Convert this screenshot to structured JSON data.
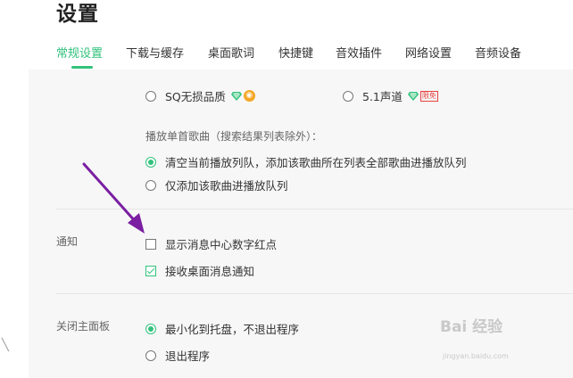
{
  "page": {
    "title": "设置"
  },
  "tabs": [
    {
      "label": "常规设置",
      "active": true
    },
    {
      "label": "下载与缓存",
      "active": false
    },
    {
      "label": "桌面歌词",
      "active": false
    },
    {
      "label": "快捷键",
      "active": false
    },
    {
      "label": "音效插件",
      "active": false
    },
    {
      "label": "网络设置",
      "active": false
    },
    {
      "label": "音频设备",
      "active": false
    }
  ],
  "quality": {
    "options": [
      {
        "label": "SQ无损品质",
        "checked": false
      },
      {
        "label": "5.1声道",
        "checked": false,
        "tag": "限免"
      }
    ]
  },
  "play_single": {
    "hint": "播放单首歌曲（搜索结果列表除外）：",
    "options": [
      {
        "label": "清空当前播放列队，添加该歌曲所在列表全部歌曲进播放队列",
        "checked": true
      },
      {
        "label": "仅添加该歌曲进播放队列",
        "checked": false
      }
    ]
  },
  "notification": {
    "label": "通知",
    "options": [
      {
        "label": "显示消息中心数字红点",
        "checked": false
      },
      {
        "label": "接收桌面消息通知",
        "checked": true
      }
    ]
  },
  "close_panel": {
    "label": "关闭主面板",
    "options": [
      {
        "label": "最小化到托盘，不退出程序",
        "checked": true
      },
      {
        "label": "退出程序",
        "checked": false
      }
    ]
  },
  "watermark": {
    "text": "Bai 经验",
    "sub": "jingyan.baidu.com"
  },
  "colors": {
    "accent": "#31c27c",
    "annotation_arrow": "#7b1fa2"
  }
}
